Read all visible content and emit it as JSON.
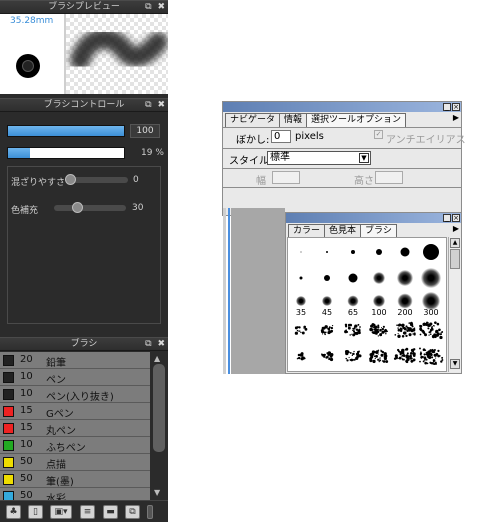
{
  "left_panel": {
    "preview": {
      "title": "ブラシプレビュー",
      "size_label": "35.28mm"
    },
    "control": {
      "title": "ブラシコントロール",
      "size_value": "100",
      "size_fill": 1.0,
      "density_value": "19 %",
      "density_fill": 0.19,
      "mix_label": "混ざりやすさ",
      "mix_value": "0",
      "mix_level": 0.0,
      "color_label": "色補充",
      "color_value": "30",
      "color_level": 0.3
    },
    "brush": {
      "title": "ブラシ",
      "items": [
        {
          "size": "20",
          "name": "鉛筆",
          "color": "#222222"
        },
        {
          "size": "10",
          "name": "ペン",
          "color": "#222222"
        },
        {
          "size": "10",
          "name": "ペン(入り抜き)",
          "color": "#222222"
        },
        {
          "size": "15",
          "name": "Gペン",
          "color": "#ee2222"
        },
        {
          "size": "15",
          "name": "丸ペン",
          "color": "#ee2222"
        },
        {
          "size": "10",
          "name": "ふちペン",
          "color": "#22aa22"
        },
        {
          "size": "50",
          "name": "点描",
          "color": "#eedd00"
        },
        {
          "size": "50",
          "name": "筆(墨)",
          "color": "#eedd00"
        },
        {
          "size": "50",
          "name": "水彩",
          "color": "#33aadd"
        }
      ],
      "toolbar_icons": [
        "brush-group-icon",
        "new-brush-icon",
        "brush-menu-icon",
        "brush-settings-icon",
        "folder-icon",
        "copy-icon"
      ]
    },
    "title_controls": {
      "popout": "⧉",
      "close": "✖"
    }
  },
  "navigator_panel": {
    "tabs": [
      "ナビゲータ",
      "情報",
      "選択ツールオプション"
    ],
    "active_tab": 2,
    "blur_label": "ぼかし:",
    "blur_value": "0",
    "blur_unit": "pixels",
    "antialias_label": "アンチエイリアス",
    "antialias_checked": true,
    "style_label": "スタイル:",
    "style_value": "標準",
    "width_label": "幅",
    "height_label": "高さ",
    "width_value": "",
    "height_value": ""
  },
  "brush_panel": {
    "tabs": [
      "カラー",
      "色見本",
      "ブラシ"
    ],
    "active_tab": 2,
    "size_labels": [
      "35",
      "45",
      "65",
      "100",
      "200",
      "300"
    ]
  }
}
